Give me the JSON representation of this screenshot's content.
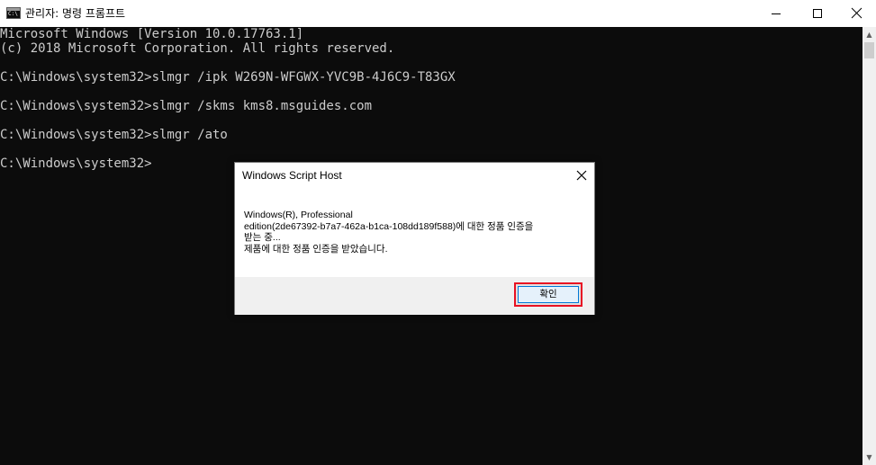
{
  "window": {
    "title": "관리자: 명령 프롬프트",
    "icon": "cmd-icon",
    "controls": {
      "minimize": "minimize-icon",
      "maximize": "maximize-icon",
      "close": "close-icon"
    }
  },
  "console": {
    "lines": [
      "Microsoft Windows [Version 10.0.17763.1]",
      "(c) 2018 Microsoft Corporation. All rights reserved.",
      "",
      "C:\\Windows\\system32>slmgr /ipk W269N-WFGWX-YVC9B-4J6C9-T83GX",
      "",
      "C:\\Windows\\system32>slmgr /skms kms8.msguides.com",
      "",
      "C:\\Windows\\system32>slmgr /ato",
      "",
      "C:\\Windows\\system32>"
    ],
    "text_color": "#cccccc",
    "background": "#0c0c0c"
  },
  "dialog": {
    "title": "Windows Script Host",
    "message_lines": [
      "Windows(R), Professional",
      "edition(2de67392-b7a7-462a-b1ca-108dd189f588)에 대한 정품 인증을",
      "받는 중...",
      "제품에 대한 정품 인증을 받았습니다."
    ],
    "ok_label": "확인",
    "highlight_color": "#e81123"
  }
}
